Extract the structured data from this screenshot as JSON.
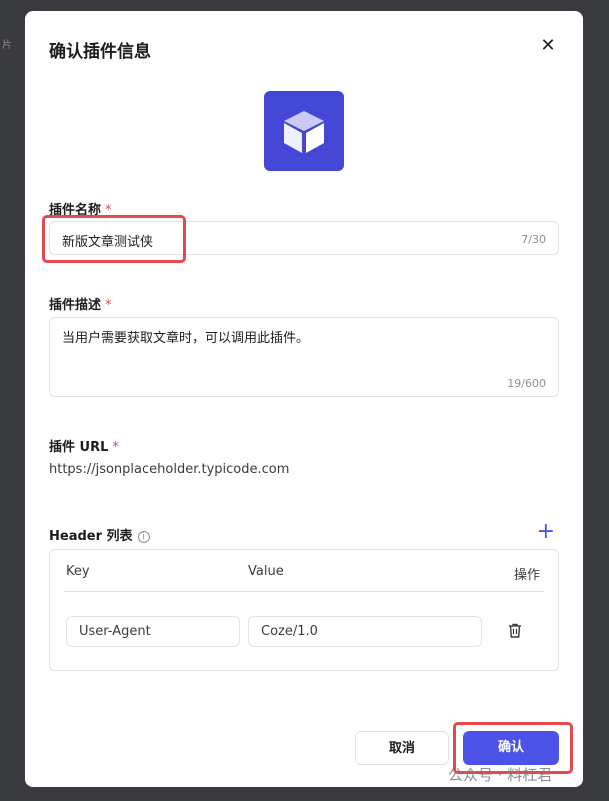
{
  "background": {
    "text": "片"
  },
  "dialog": {
    "title": "确认插件信息",
    "close_icon": "close-icon",
    "logo_icon": "cube-icon",
    "fields": {
      "name": {
        "label": "插件名称",
        "required_mark": "*",
        "value": "新版文章测试侠",
        "counter": "7/30"
      },
      "description": {
        "label": "插件描述",
        "required_mark": "*",
        "value": "当用户需要获取文章时，可以调用此插件。",
        "counter": "19/600"
      },
      "url": {
        "label": "插件 URL",
        "required_mark": "*",
        "value": "https://jsonplaceholder.typicode.com"
      }
    },
    "header_list": {
      "label": "Header 列表",
      "info_icon": "i",
      "add_icon": "+",
      "columns": {
        "key": "Key",
        "value": "Value",
        "actions": "操作"
      },
      "rows": [
        {
          "key": "User-Agent",
          "value": "Coze/1.0"
        }
      ]
    },
    "buttons": {
      "cancel": "取消",
      "confirm": "确认"
    }
  },
  "colors": {
    "accent": "#4d53e8",
    "logo_bg": "#4447d6",
    "required": "#e5484d",
    "highlight": "#e5484d"
  },
  "watermark": {
    "text": "公众号 · 料杠君"
  }
}
